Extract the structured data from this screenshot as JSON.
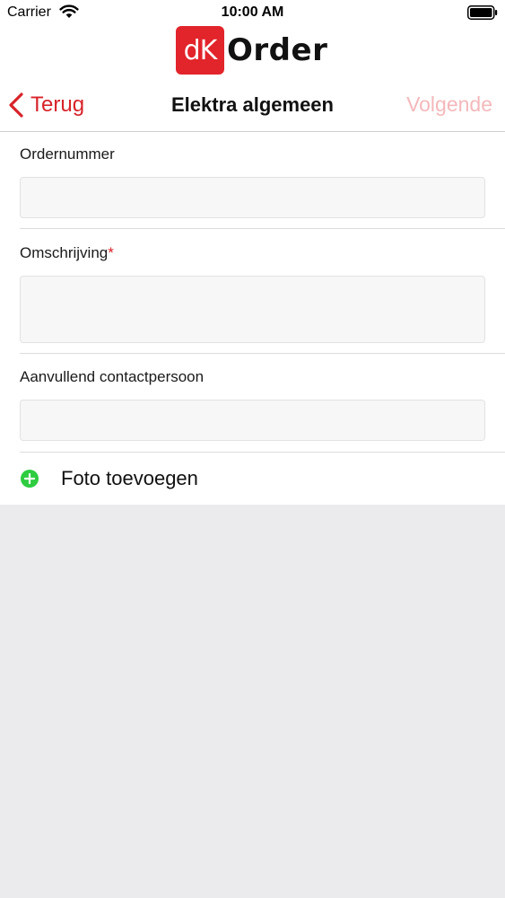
{
  "status_bar": {
    "carrier": "Carrier",
    "time": "10:00 AM",
    "wifi_icon": "wifi-icon",
    "battery_icon": "battery-icon"
  },
  "logo": {
    "badge_text": "dK",
    "word": "Order",
    "badge_color": "#e2242b"
  },
  "nav": {
    "back_label": "Terug",
    "back_icon": "chevron-left-icon",
    "title": "Elektra algemeen",
    "next_label": "Volgende",
    "accent_color": "#d8232a",
    "next_disabled_color": "#f4b8bb"
  },
  "form": {
    "order_number": {
      "label": "Ordernummer",
      "value": ""
    },
    "description": {
      "label": "Omschrijving",
      "required_marker": "*",
      "value": ""
    },
    "contact_person": {
      "label": "Aanvullend contactpersoon",
      "value": ""
    }
  },
  "add_photo": {
    "label": "Foto toevoegen",
    "icon": "plus-circle-icon",
    "icon_color": "#2ecc40"
  }
}
